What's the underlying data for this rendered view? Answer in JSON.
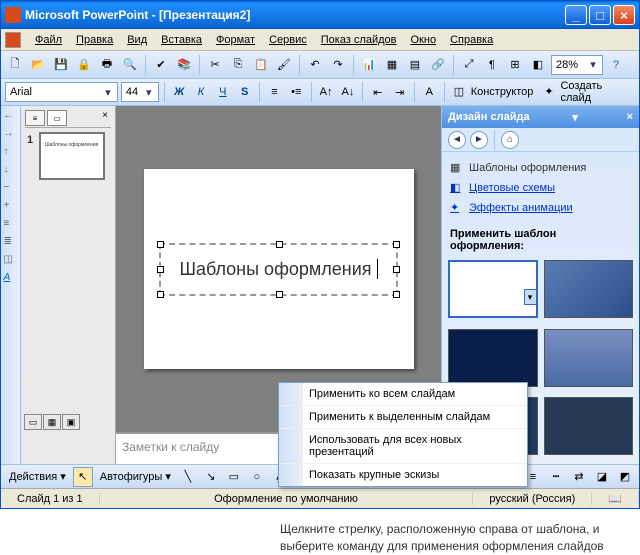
{
  "title": "Microsoft PowerPoint  - [Презентация2]",
  "menus": [
    "Файл",
    "Правка",
    "Вид",
    "Вставка",
    "Формат",
    "Сервис",
    "Показ слайдов",
    "Окно",
    "Справка"
  ],
  "zoom": "28%",
  "font": {
    "name": "Arial",
    "size": "44"
  },
  "toolbar_labels": {
    "designer": "Конструктор",
    "new_slide": "Создать слайд"
  },
  "slide_text": "Шаблоны оформления",
  "notes_placeholder": "Заметки к слайду",
  "thumb_number": "1",
  "taskpane": {
    "title": "Дизайн слайда",
    "links": {
      "templates": "Шаблоны оформления",
      "colors": "Цветовые схемы",
      "anim": "Эффекты анимации"
    },
    "section": "Применить шаблон оформления:"
  },
  "context_menu": [
    "Применить ко всем слайдам",
    "Применить к выделенным слайдам",
    "Использовать для всех новых презентаций",
    "Показать крупные эскизы"
  ],
  "draw": {
    "actions": "Действия",
    "autoshapes": "Автофигуры"
  },
  "status": {
    "slide": "Слайд 1 из 1",
    "design": "Оформление по умолчанию",
    "lang": "русский (Россия)"
  },
  "caption": "Щелкните стрелку, расположенную справа от шаблона, и выберите команду для применения оформления слайдов"
}
